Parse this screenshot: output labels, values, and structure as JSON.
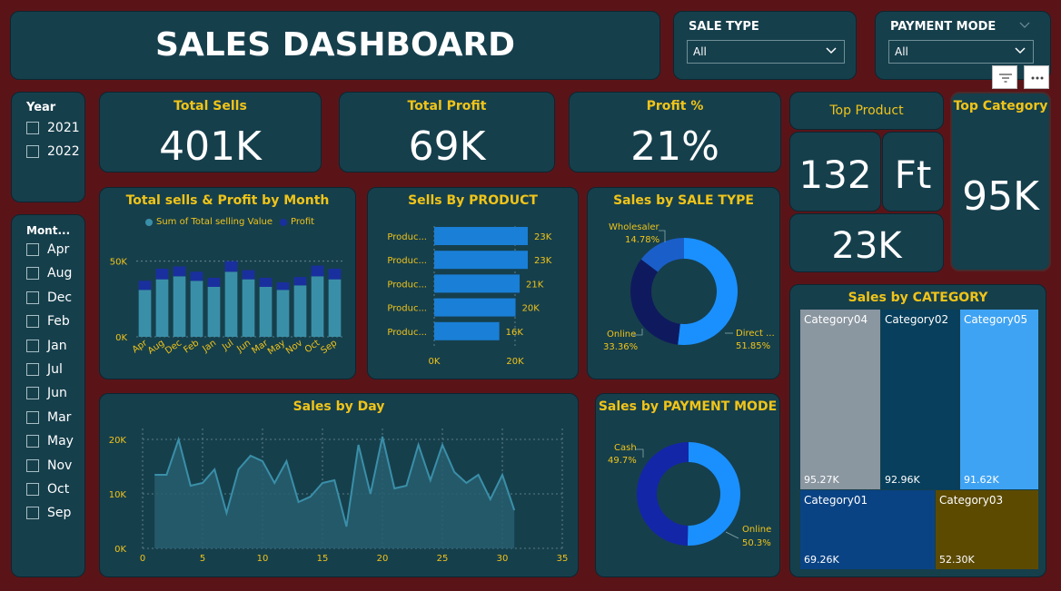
{
  "header": {
    "title": "SALES DASHBOARD"
  },
  "filters": {
    "sale_type": {
      "label": "SALE TYPE",
      "value": "All"
    },
    "payment_mode": {
      "label": "PAYMENT MODE",
      "value": "All"
    }
  },
  "slicers": {
    "year": {
      "title": "Year",
      "items": [
        "2021",
        "2022"
      ]
    },
    "month": {
      "title": "Mont...",
      "items": [
        "Apr",
        "Aug",
        "Dec",
        "Feb",
        "Jan",
        "Jul",
        "Jun",
        "Mar",
        "May",
        "Nov",
        "Oct",
        "Sep"
      ]
    }
  },
  "kpis": {
    "total_sells": {
      "label": "Total Sells",
      "value": "401K"
    },
    "total_profit": {
      "label": "Total Profit",
      "value": "69K"
    },
    "profit_pct": {
      "label": "Profit %",
      "value": "21%"
    },
    "top_product": {
      "label": "Top Product",
      "number": "132",
      "unit": "Ft",
      "value": "23K"
    },
    "top_category": {
      "label": "Top Category",
      "value": "95K"
    }
  },
  "chart_data": [
    {
      "type": "bar",
      "title": "Total sells & Profit by Month",
      "legend": [
        "Sum of Total selling Value",
        "Profit"
      ],
      "legend_position": "top",
      "categories": [
        "Apr",
        "Aug",
        "Dec",
        "Feb",
        "Jan",
        "Jul",
        "Jun",
        "Mar",
        "May",
        "Nov",
        "Oct",
        "Sep"
      ],
      "series": [
        {
          "name": "Sum of Total selling Value",
          "values": [
            31000,
            38000,
            40000,
            37000,
            33000,
            43000,
            38000,
            33000,
            31000,
            34000,
            40000,
            38000
          ]
        },
        {
          "name": "Profit",
          "values": [
            6000,
            7000,
            6500,
            6000,
            6000,
            7000,
            6000,
            6000,
            5000,
            5500,
            7000,
            7000
          ]
        }
      ],
      "yticks": [
        "0K",
        "50K"
      ],
      "ylim": [
        0,
        60000
      ],
      "grid": true,
      "colors": {
        "sells": "#3a8fa8",
        "profit": "#1a2f9e"
      }
    },
    {
      "type": "bar",
      "orientation": "horizontal",
      "title": "Sells By PRODUCT",
      "categories": [
        "Produc...",
        "Produc...",
        "Produc...",
        "Produc...",
        "Produc..."
      ],
      "value_labels": [
        "23K",
        "23K",
        "21K",
        "20K",
        "16K"
      ],
      "values": [
        23000,
        23000,
        21000,
        20000,
        16000
      ],
      "xticks": [
        "0K",
        "20K"
      ],
      "xlim": [
        0,
        23000
      ],
      "colors": {
        "bar": "#1a7fd6"
      }
    },
    {
      "type": "pie",
      "donut": true,
      "title": "Sales by SALE TYPE",
      "slices": [
        {
          "name": "Direct ...",
          "pct_label": "51.85%",
          "value": 51.85,
          "color": "#1a90ff"
        },
        {
          "name": "Online",
          "pct_label": "33.36%",
          "value": 33.36,
          "color": "#0f1a5e"
        },
        {
          "name": "Wholesaler",
          "pct_label": "14.78%",
          "value": 14.78,
          "color": "#1a5fc9"
        }
      ]
    },
    {
      "type": "area",
      "title": "Sales by Day",
      "x": [
        1,
        2,
        3,
        4,
        5,
        6,
        7,
        8,
        9,
        10,
        11,
        12,
        13,
        14,
        15,
        16,
        17,
        18,
        19,
        20,
        21,
        22,
        23,
        24,
        25,
        26,
        27,
        28,
        29,
        30,
        31
      ],
      "y": [
        13500,
        13500,
        20000,
        11500,
        12000,
        14500,
        6500,
        14500,
        17000,
        16000,
        12000,
        16000,
        8500,
        9500,
        12000,
        12500,
        4000,
        19000,
        10000,
        20500,
        11000,
        11500,
        19000,
        12500,
        19000,
        14000,
        12000,
        13500,
        9000,
        13500,
        7000
      ],
      "xticks": [
        "0",
        "5",
        "10",
        "15",
        "20",
        "25",
        "30",
        "35"
      ],
      "yticks": [
        "0K",
        "10K",
        "20K"
      ],
      "xlim": [
        0,
        35
      ],
      "ylim": [
        0,
        22000
      ],
      "grid": true,
      "colors": {
        "line": "#3a8fa8",
        "fill": "#275e70"
      }
    },
    {
      "type": "pie",
      "donut": true,
      "title": "Sales by PAYMENT MODE",
      "slices": [
        {
          "name": "Online",
          "pct_label": "50.3%",
          "value": 50.3,
          "color": "#1a90ff"
        },
        {
          "name": "Cash",
          "pct_label": "49.7%",
          "value": 49.7,
          "color": "#1326a8"
        }
      ]
    },
    {
      "type": "treemap",
      "title": "Sales by CATEGORY",
      "items": [
        {
          "name": "Category04",
          "value_label": "95.27K",
          "value": 95.27,
          "color": "#8a96a0"
        },
        {
          "name": "Category02",
          "value_label": "92.96K",
          "value": 92.96,
          "color": "#073f5c"
        },
        {
          "name": "Category05",
          "value_label": "91.62K",
          "value": 91.62,
          "color": "#3fa3f3"
        },
        {
          "name": "Category01",
          "value_label": "69.26K",
          "value": 69.26,
          "color": "#0a4384"
        },
        {
          "name": "Category03",
          "value_label": "52.30K",
          "value": 52.3,
          "color": "#5c4a00"
        }
      ]
    }
  ]
}
